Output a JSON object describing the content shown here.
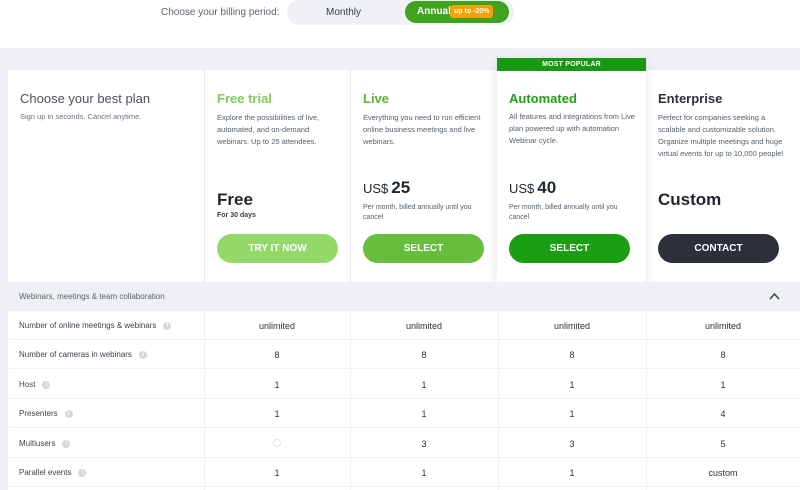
{
  "billing": {
    "label": "Choose your billing period:",
    "monthly": "Monthly",
    "annual": "Annual",
    "discount_badge": "up to -20%"
  },
  "intro": {
    "title": "Choose your best plan",
    "subtitle": "Sign up in seconds. Cancel anytime."
  },
  "plans": [
    {
      "name": "Free trial",
      "description": "Explore the possibilities of live, automated, and on-demand webinars. Up to 25 attendees.",
      "price": "Free",
      "price_sub": "For 30 days",
      "button": "TRY IT NOW",
      "name_color": "#7fcb59",
      "button_color": "#93d868"
    },
    {
      "name": "Live",
      "description": "Everything you need to run efficient online business meetings and live webinars.",
      "currency": "US$",
      "price": "25",
      "price_note": "Per month, billed annually until you cancel",
      "button": "SELECT",
      "name_color": "#56b52f",
      "button_color": "#67bd3c"
    },
    {
      "name": "Automated",
      "ribbon": "MOST POPULAR",
      "description": "All features and integrations from Live plan powered up with automation Webinar cycle.",
      "currency": "US$",
      "price": "40",
      "price_note": "Per month, billed annually until you cancel",
      "button": "SELECT",
      "name_color": "#20a116",
      "button_color": "#1c9e12"
    },
    {
      "name": "Enterprise",
      "description": "Perfect for companies seeking a scalable and customizable solution. Organize multiple meetings and huge virtual events for up to 10,000 people!",
      "price": "Custom",
      "button": "CONTACT",
      "name_color": "#2b3138",
      "button_color": "#2c3038"
    }
  ],
  "section": {
    "title": "Webinars, meetings & team collaboration"
  },
  "features": [
    {
      "label": "Number of online meetings & webinars",
      "values": [
        "unlimited",
        "unlimited",
        "unlimited",
        "unlimited"
      ]
    },
    {
      "label": "Number of cameras in webinars",
      "values": [
        "8",
        "8",
        "8",
        "8"
      ]
    },
    {
      "label": "Host",
      "values": [
        "1",
        "1",
        "1",
        "1"
      ]
    },
    {
      "label": "Presenters",
      "values": [
        "1",
        "1",
        "1",
        "4"
      ]
    },
    {
      "label": "Multiusers",
      "values": [
        "",
        "3",
        "3",
        "5"
      ]
    },
    {
      "label": "Parallel events",
      "values": [
        "1",
        "1",
        "1",
        "custom"
      ]
    }
  ]
}
